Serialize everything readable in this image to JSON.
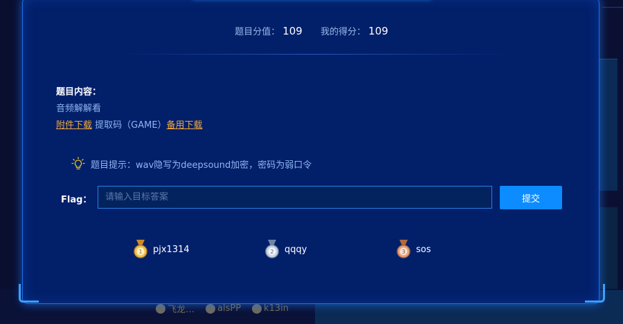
{
  "challenge": {
    "score_label": "题目分值：",
    "score_value": "109",
    "my_score_label": "我的得分：",
    "my_score_value": "109",
    "content_title": "题目内容：",
    "description": "音频解解看",
    "attachment_link": "附件下载",
    "extract_code": " 提取码（GAME）",
    "backup_link": "备用下载",
    "hint": "题目提示：wav隐写为deepsound加密，密码为弱口令"
  },
  "flag_form": {
    "label": "Flag：",
    "placeholder": "请输入目标答案",
    "value": "",
    "submit_label": "提交"
  },
  "solvers": [
    {
      "rank": "1",
      "name": "pjx1314",
      "color": "#d9a441"
    },
    {
      "rank": "2",
      "name": "qqqy",
      "color": "#9fb4cc"
    },
    {
      "rank": "3",
      "name": "sos",
      "color": "#d08a5a"
    }
  ],
  "background_solvers": [
    "飞龙…",
    "alsPP",
    "k13in"
  ],
  "colors": {
    "modal_bg": "#021f6a",
    "accent": "#0c8cff",
    "link": "#f2a93b"
  }
}
